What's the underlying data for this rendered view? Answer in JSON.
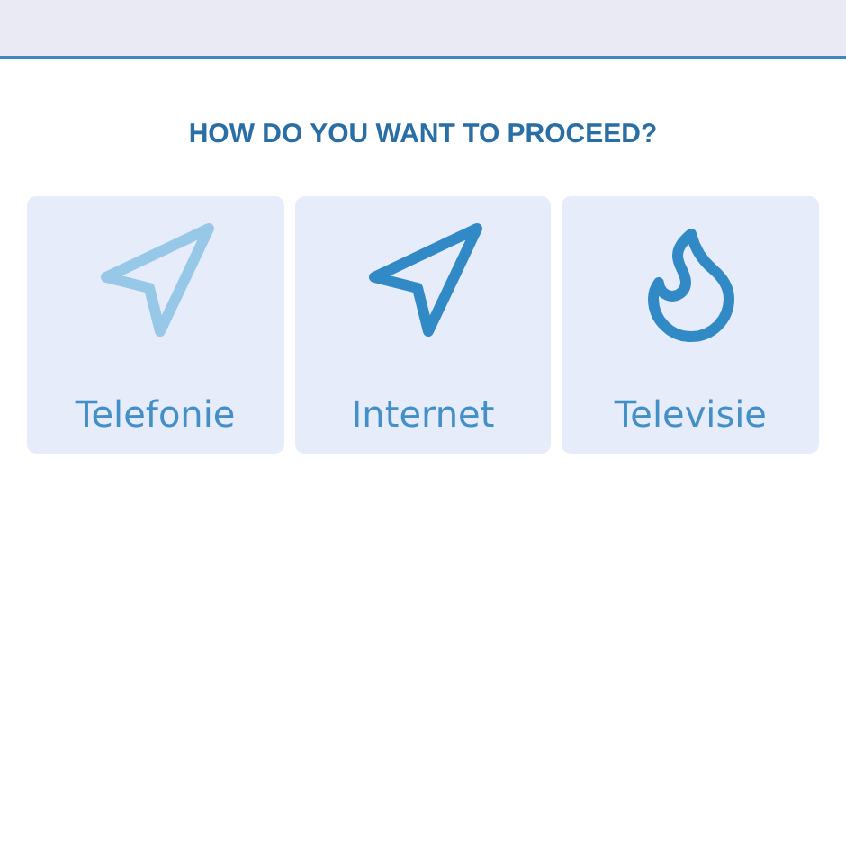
{
  "heading": "HOW DO YOU WANT TO PROCEED?",
  "options": [
    {
      "label": "Telefonie",
      "kind": "arrow",
      "faded": true
    },
    {
      "label": "Internet",
      "kind": "arrow",
      "faded": false
    },
    {
      "label": "Televisie",
      "kind": "flame",
      "faded": false
    }
  ]
}
